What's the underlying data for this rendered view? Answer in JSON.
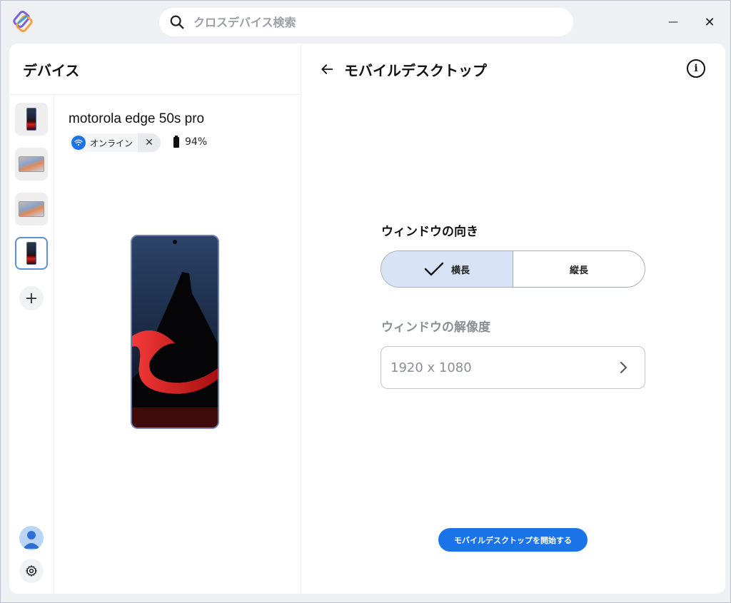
{
  "titlebar": {
    "search_placeholder": "クロスデバイス検索",
    "minimize_label": "—",
    "close_label": "✕"
  },
  "left_panel": {
    "title": "デバイス",
    "rail": [
      "phone",
      "monitor",
      "monitor",
      "phone"
    ],
    "add_label": "+"
  },
  "device": {
    "name": "motorola edge 50s pro",
    "status": "オンライン",
    "disconnect_label": "✕",
    "battery": "94%"
  },
  "right_panel": {
    "back_label": "←",
    "title": "モバイルデスクトップ",
    "info_label": "i",
    "orientation_label": "ウィンドウの向き",
    "orientation_options": [
      "横長",
      "縦長"
    ],
    "orientation_selected": "横長",
    "resolution_label": "ウィンドウの解像度",
    "resolution_value": "1920 x 1080",
    "start_button": "モバイルデスクトップを開始する"
  },
  "colors": {
    "accent": "#1a73e8",
    "selected_segment": "#d8e3f5",
    "window_bg": "#eef0f3"
  }
}
